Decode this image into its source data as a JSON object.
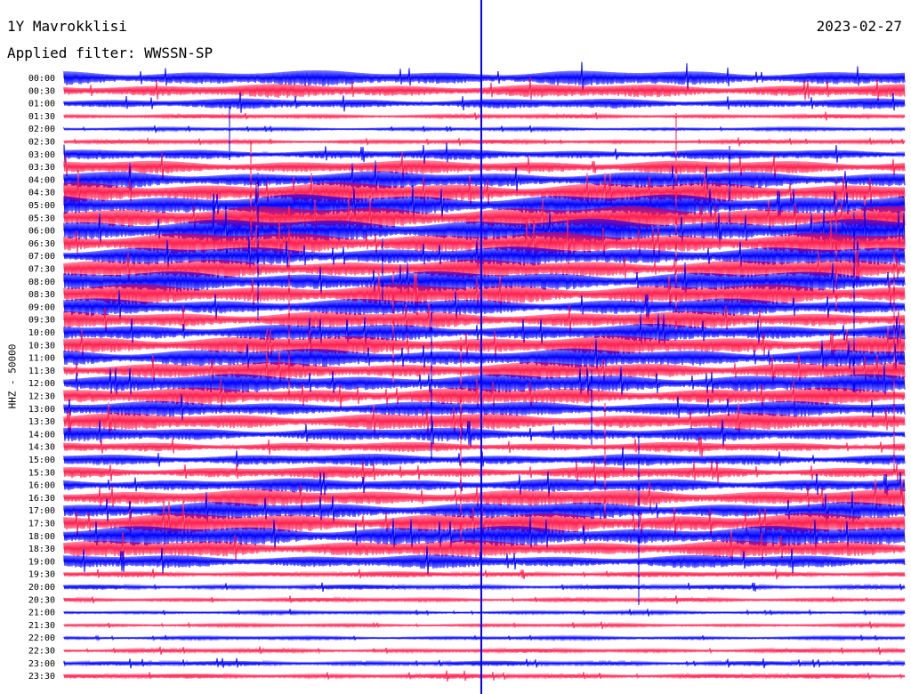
{
  "header": {
    "station": "1Y Mavrokklisi",
    "date": "2023-02-27",
    "filter": "Applied filter: WWSSN-SP"
  },
  "chart_data": {
    "type": "line",
    "channel_label": "HHZ - 50000",
    "colors": [
      "#0000ff",
      "#ff1f4f"
    ],
    "grid": false,
    "rows": [
      {
        "label": "00:00",
        "amp": 0.9
      },
      {
        "label": "00:30",
        "amp": 0.8
      },
      {
        "label": "01:00",
        "amp": 0.6
      },
      {
        "label": "01:30",
        "amp": 0.25
      },
      {
        "label": "02:00",
        "amp": 0.2
      },
      {
        "label": "02:30",
        "amp": 0.25
      },
      {
        "label": "03:00",
        "amp": 0.6
      },
      {
        "label": "03:30",
        "amp": 0.8
      },
      {
        "label": "04:00",
        "amp": 1.0
      },
      {
        "label": "04:30",
        "amp": 1.2
      },
      {
        "label": "05:00",
        "amp": 1.3
      },
      {
        "label": "05:30",
        "amp": 1.4
      },
      {
        "label": "06:00",
        "amp": 1.4
      },
      {
        "label": "06:30",
        "amp": 1.3
      },
      {
        "label": "07:00",
        "amp": 1.1
      },
      {
        "label": "07:30",
        "amp": 1.1
      },
      {
        "label": "08:00",
        "amp": 1.2
      },
      {
        "label": "08:30",
        "amp": 1.2
      },
      {
        "label": "09:00",
        "amp": 1.0
      },
      {
        "label": "09:30",
        "amp": 1.0
      },
      {
        "label": "10:00",
        "amp": 1.0
      },
      {
        "label": "10:30",
        "amp": 1.1
      },
      {
        "label": "11:00",
        "amp": 1.1
      },
      {
        "label": "11:30",
        "amp": 1.0
      },
      {
        "label": "12:00",
        "amp": 1.1
      },
      {
        "label": "12:30",
        "amp": 1.0
      },
      {
        "label": "13:00",
        "amp": 0.9
      },
      {
        "label": "13:30",
        "amp": 1.0
      },
      {
        "label": "14:00",
        "amp": 0.8
      },
      {
        "label": "14:30",
        "amp": 0.6
      },
      {
        "label": "15:00",
        "amp": 0.7
      },
      {
        "label": "15:30",
        "amp": 0.7
      },
      {
        "label": "16:00",
        "amp": 0.8
      },
      {
        "label": "16:30",
        "amp": 1.0
      },
      {
        "label": "17:00",
        "amp": 1.0
      },
      {
        "label": "17:30",
        "amp": 1.2
      },
      {
        "label": "18:00",
        "amp": 1.2
      },
      {
        "label": "18:30",
        "amp": 1.0
      },
      {
        "label": "19:00",
        "amp": 0.8
      },
      {
        "label": "19:30",
        "amp": 0.35
      },
      {
        "label": "20:00",
        "amp": 0.3
      },
      {
        "label": "20:30",
        "amp": 0.25
      },
      {
        "label": "21:00",
        "amp": 0.2
      },
      {
        "label": "21:30",
        "amp": 0.2
      },
      {
        "label": "22:00",
        "amp": 0.2
      },
      {
        "label": "22:30",
        "amp": 0.25
      },
      {
        "label": "23:00",
        "amp": 0.3
      },
      {
        "label": "23:30",
        "amp": 0.3
      }
    ]
  }
}
